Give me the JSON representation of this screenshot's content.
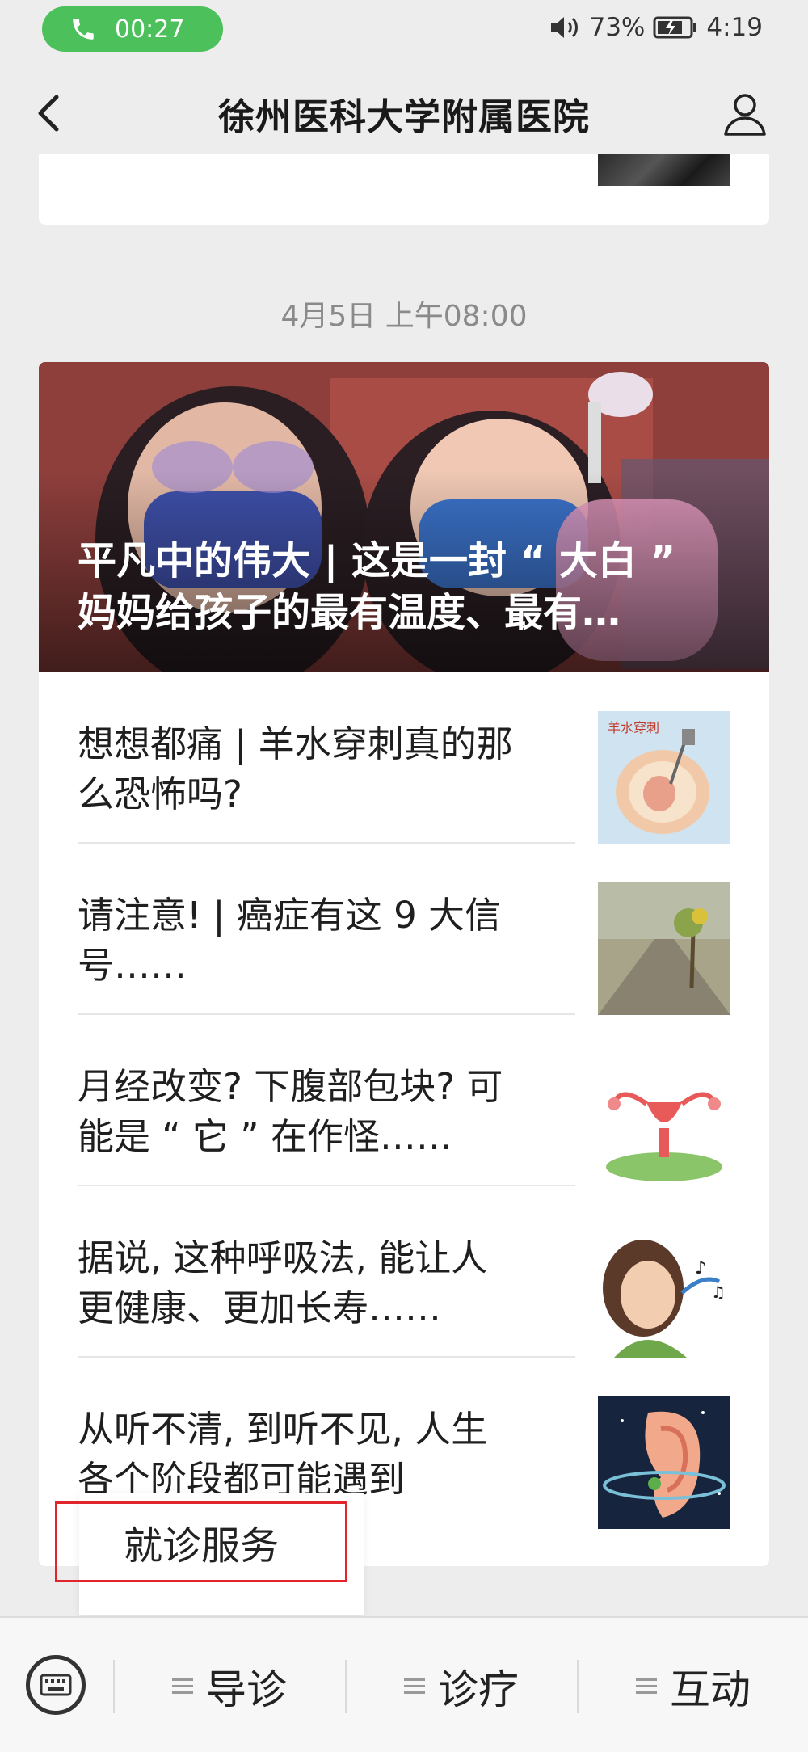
{
  "status_bar": {
    "call_time": "00:27",
    "battery": "73%",
    "clock": "4:19",
    "icons": [
      "phone-icon",
      "volume-icon",
      "battery-icon"
    ]
  },
  "nav": {
    "title": "徐州医科大学附属医院",
    "back_icon": "chevron-left-icon",
    "profile_icon": "person-icon"
  },
  "timestamp": "4月5日 上午08:00",
  "feed": {
    "cover_title": "平凡中的伟大 | 这是一封 “ 大白 ”\n妈妈给孩子的最有温度、最有…",
    "articles": [
      {
        "title": "想想都痛 | 羊水穿刺真的那\n么恐怖吗?",
        "thumb_label": "羊水穿刺"
      },
      {
        "title": "请注意! | 癌症有这 9 大信\n号……"
      },
      {
        "title": "月经改变? 下腹部包块? 可\n能是 “ 它 ” 在作怪……"
      },
      {
        "title": "据说, 这种呼吸法, 能让人\n更健康、更加长寿……"
      },
      {
        "title": "从听不清, 到听不见, 人生\n各个阶段都可能遇到"
      }
    ]
  },
  "popup_menu": {
    "item": "就诊服务"
  },
  "bottom_menu": {
    "keyboard_icon": "keyboard-icon",
    "items": [
      {
        "label": "导诊"
      },
      {
        "label": "诊疗"
      },
      {
        "label": "互动"
      }
    ]
  },
  "colors": {
    "call_green": "#4cc05a",
    "highlight_red": "#e0262a",
    "background": "#ededed"
  }
}
